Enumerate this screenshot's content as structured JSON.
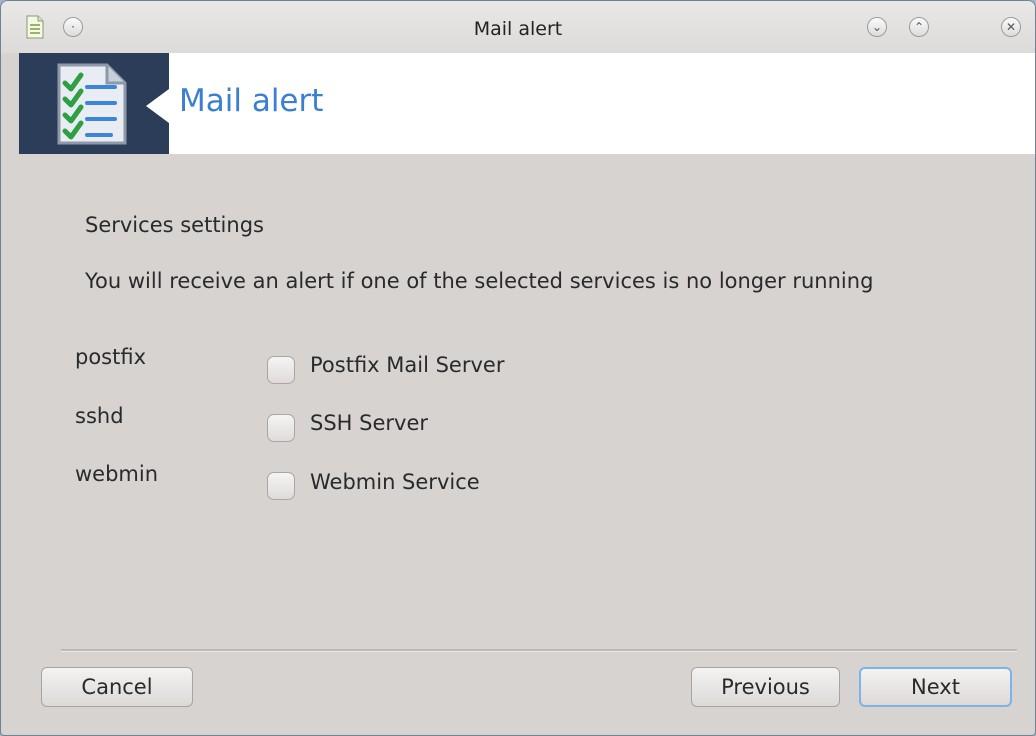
{
  "window": {
    "title": "Mail alert",
    "controls": [
      "menu-icon",
      "minimize-icon",
      "maximize-icon",
      "close-icon"
    ],
    "titlebar_glyphs": {
      "menu": "·",
      "minimize": "⌄",
      "maximize": "⌃",
      "close": "✕"
    }
  },
  "banner": {
    "title": "Mail alert",
    "icon": "checklist-icon",
    "colors": {
      "left_panel": "#2b3d58",
      "title": "#3a7fd1"
    }
  },
  "content": {
    "heading": "Services settings",
    "description": "You will receive an alert if one of the selected services is no longer running",
    "services": [
      {
        "name": "postfix",
        "label": "Postfix Mail Server",
        "checked": false
      },
      {
        "name": "sshd",
        "label": "SSH Server",
        "checked": false
      },
      {
        "name": "webmin",
        "label": "Webmin Service",
        "checked": false
      }
    ]
  },
  "buttons": {
    "cancel": "Cancel",
    "previous": "Previous",
    "next": "Next"
  }
}
